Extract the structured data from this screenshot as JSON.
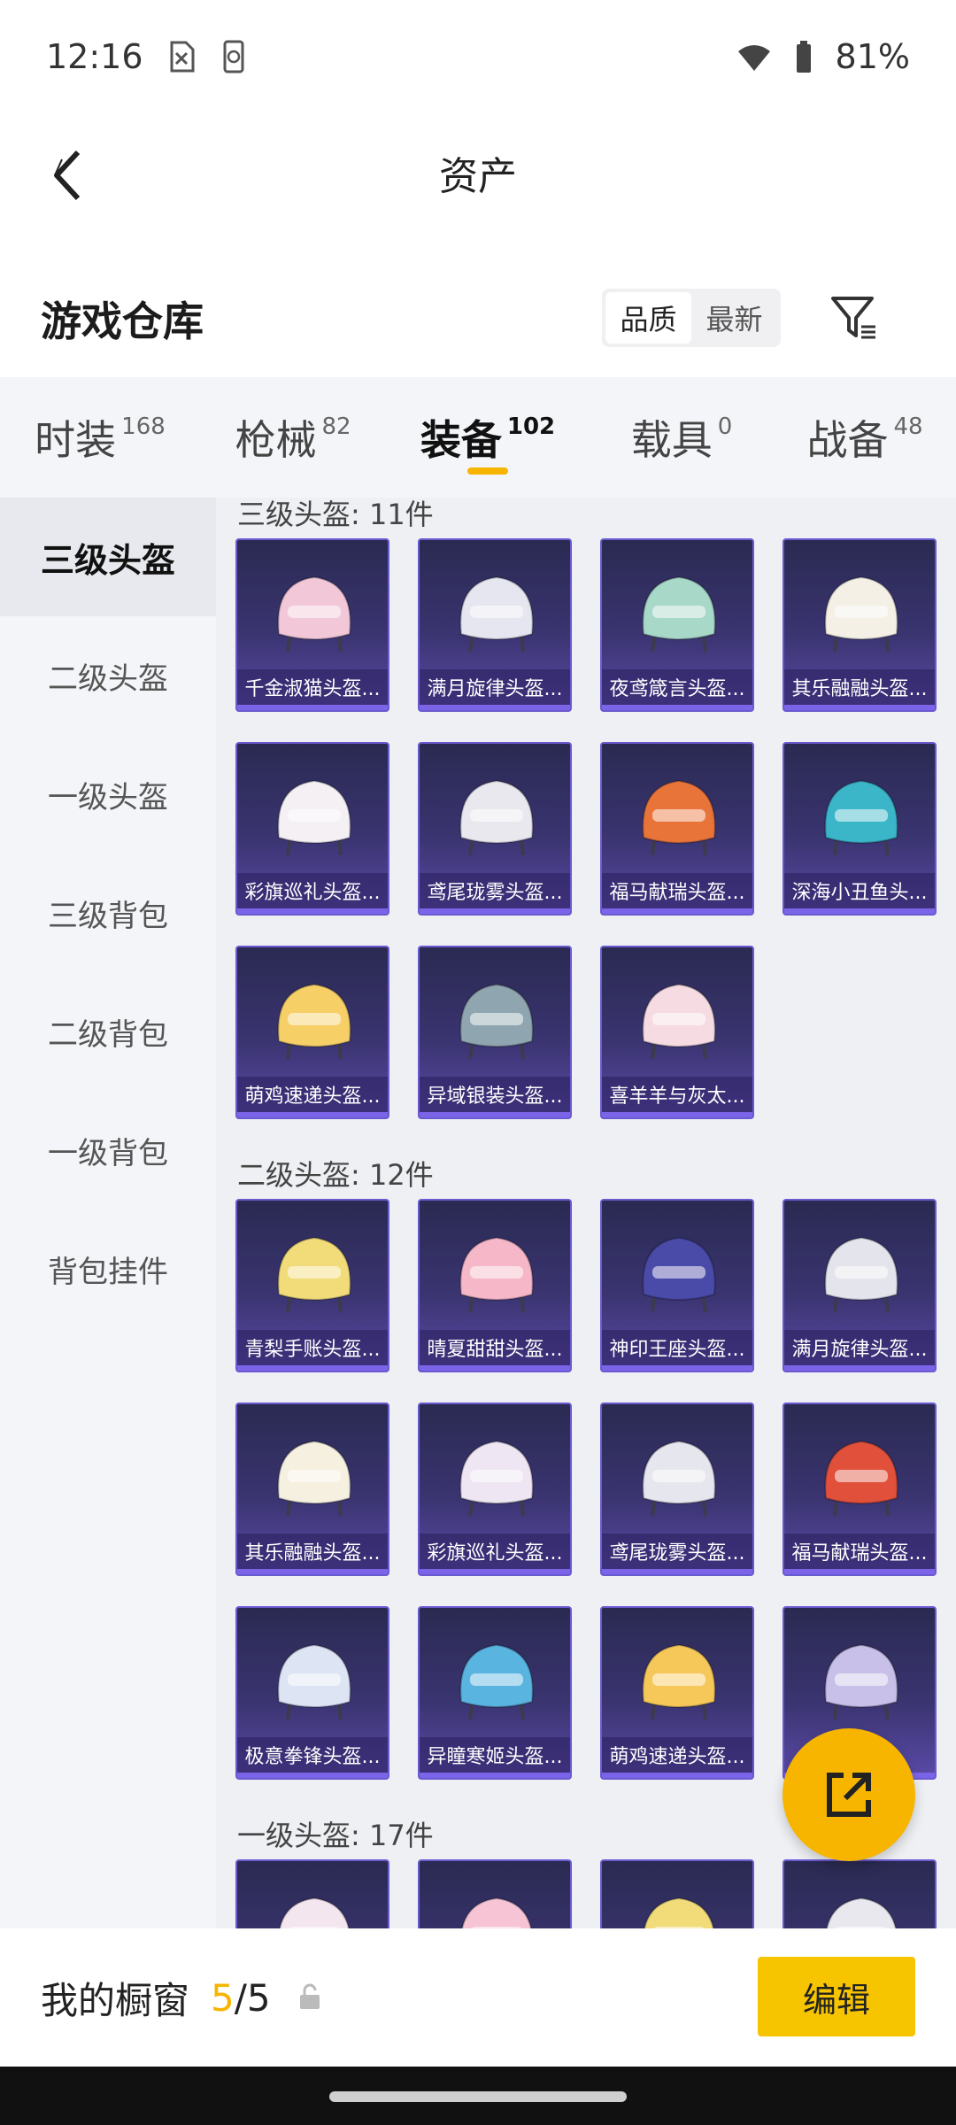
{
  "status_bar": {
    "time": "12:16",
    "battery": "81%"
  },
  "nav": {
    "title": "资产"
  },
  "subheader": {
    "title": "游戏仓库",
    "sort_options": [
      "品质",
      "最新"
    ]
  },
  "tabs": [
    {
      "label": "时装",
      "count": "168"
    },
    {
      "label": "枪械",
      "count": "82"
    },
    {
      "label": "装备",
      "count": "102"
    },
    {
      "label": "载具",
      "count": "0"
    },
    {
      "label": "战备",
      "count": "48"
    }
  ],
  "sidebar": [
    "三级头盔",
    "二级头盔",
    "一级头盔",
    "三级背包",
    "二级背包",
    "一级背包",
    "背包挂件"
  ],
  "sections": [
    {
      "title": "三级头盔: 11件",
      "items": [
        {
          "name": "千金淑猫头盔...",
          "color": "#f2c8d8"
        },
        {
          "name": "满月旋律头盔...",
          "color": "#e6e6f0"
        },
        {
          "name": "夜鸢箴言头盔...",
          "color": "#a8d8c8"
        },
        {
          "name": "其乐融融头盔...",
          "color": "#f4f0e6"
        },
        {
          "name": "彩旗巡礼头盔...",
          "color": "#f4f0f4"
        },
        {
          "name": "鸢尾珑雾头盔...",
          "color": "#e8e8ee"
        },
        {
          "name": "福马献瑞头盔...",
          "color": "#e8743a"
        },
        {
          "name": "深海小丑鱼头...",
          "color": "#3ab6c8"
        },
        {
          "name": "萌鸡速递头盔...",
          "color": "#f6cf66"
        },
        {
          "name": "异域银装头盔...",
          "color": "#8fa6b0"
        },
        {
          "name": "喜羊羊与灰太...",
          "color": "#f6dce2"
        }
      ]
    },
    {
      "title": "二级头盔: 12件",
      "items": [
        {
          "name": "青梨手账头盔...",
          "color": "#f2dc7a"
        },
        {
          "name": "晴夏甜甜头盔...",
          "color": "#f6b8c8"
        },
        {
          "name": "神印王座头盔...",
          "color": "#4a4aa8"
        },
        {
          "name": "满月旋律头盔...",
          "color": "#e4e4ec"
        },
        {
          "name": "其乐融融头盔...",
          "color": "#f6f0e0"
        },
        {
          "name": "彩旗巡礼头盔...",
          "color": "#eee6f2"
        },
        {
          "name": "鸢尾珑雾头盔...",
          "color": "#e6e6ee"
        },
        {
          "name": "福马献瑞头盔...",
          "color": "#e0503a"
        },
        {
          "name": "极意拳锋头盔...",
          "color": "#dde4f4"
        },
        {
          "name": "异瞳寒姬头盔...",
          "color": "#5ab4e0"
        },
        {
          "name": "萌鸡速递头盔...",
          "color": "#f6c85a"
        },
        {
          "name": "",
          "color": "#c8c0e8"
        }
      ]
    },
    {
      "title": "一级头盔: 17件",
      "items": [
        {
          "name": "",
          "color": "#f4e6ee"
        },
        {
          "name": "",
          "color": "#f6c4d4"
        },
        {
          "name": "",
          "color": "#f2dc7a"
        },
        {
          "name": "",
          "color": "#e8e8ee"
        }
      ]
    }
  ],
  "showcase": {
    "label": "我的橱窗",
    "count_current": "5",
    "count_sep": "/",
    "count_total": "5",
    "edit_label": "编辑"
  },
  "colors": {
    "accent": "#f7b500",
    "card_bg": "#3a3470",
    "card_border": "#6a5ad0"
  }
}
